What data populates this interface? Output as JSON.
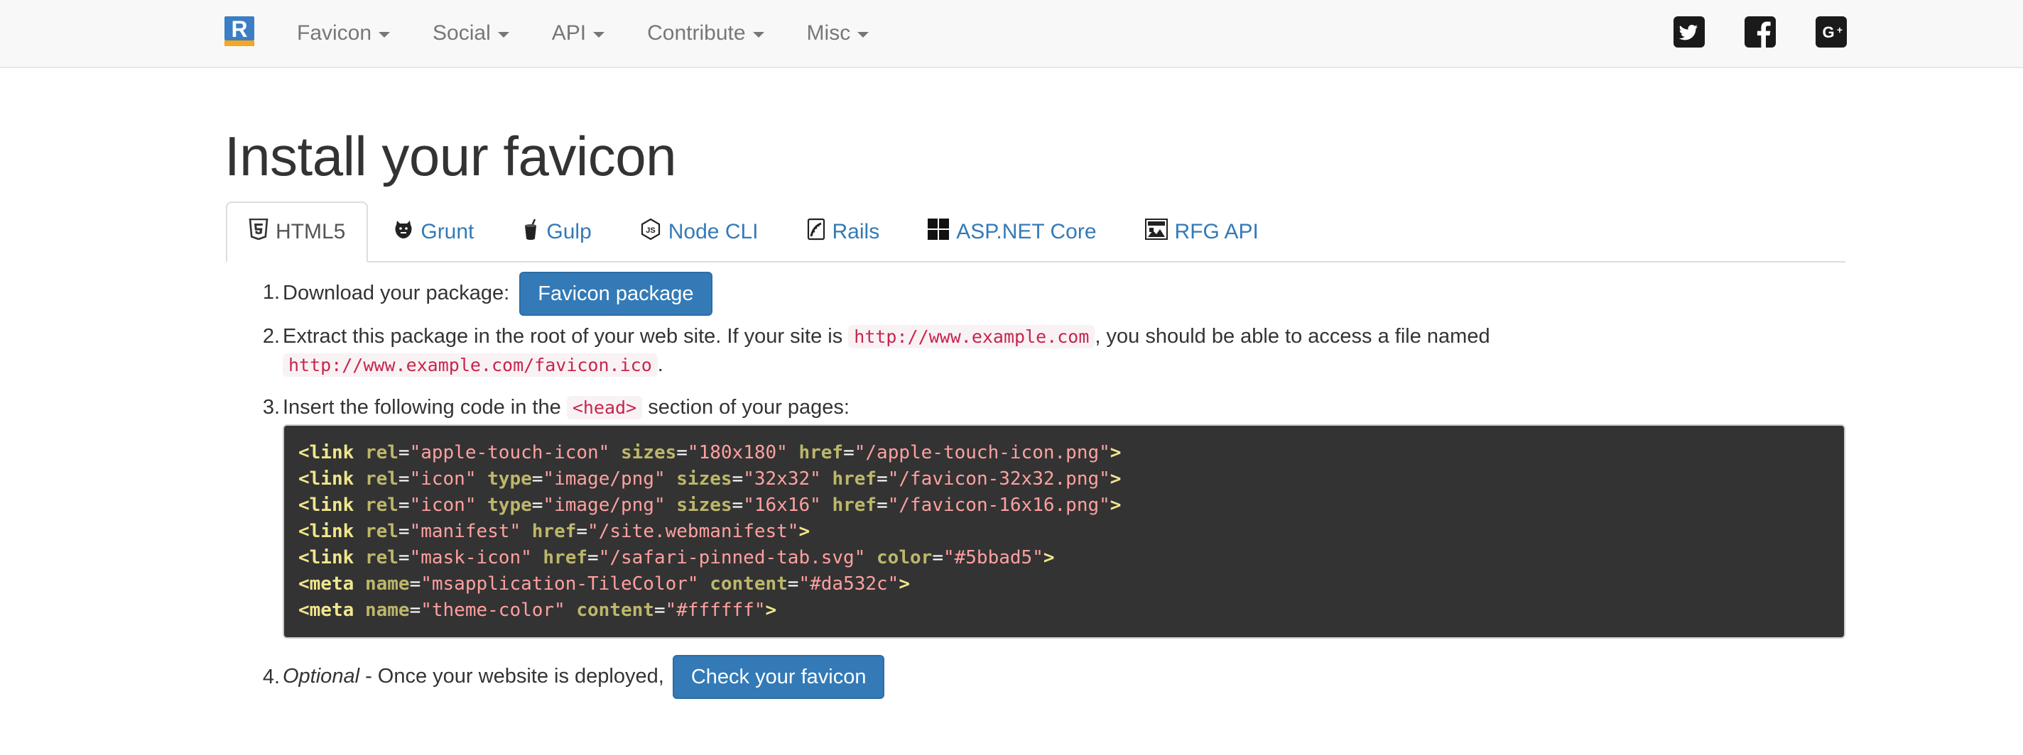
{
  "navbar": {
    "brand_icon": "realfavicongenerator-logo-icon",
    "menu": [
      {
        "label": "Favicon"
      },
      {
        "label": "Social"
      },
      {
        "label": "API"
      },
      {
        "label": "Contribute"
      },
      {
        "label": "Misc"
      }
    ],
    "social_icons": [
      "twitter-icon",
      "facebook-icon",
      "google-plus-icon"
    ]
  },
  "page": {
    "title": "Install your favicon"
  },
  "tabs": [
    {
      "label": "HTML5",
      "icon": "html5-icon",
      "active": true
    },
    {
      "label": "Grunt",
      "icon": "grunt-icon",
      "active": false
    },
    {
      "label": "Gulp",
      "icon": "gulp-icon",
      "active": false
    },
    {
      "label": "Node CLI",
      "icon": "nodejs-icon",
      "active": false
    },
    {
      "label": "Rails",
      "icon": "rails-icon",
      "active": false
    },
    {
      "label": "ASP.NET Core",
      "icon": "windows-icon",
      "active": false
    },
    {
      "label": "RFG API",
      "icon": "rfg-api-icon",
      "active": false
    }
  ],
  "steps": {
    "step1": {
      "number": "1.",
      "text": "Download your package:",
      "button_label": "Favicon package"
    },
    "step2": {
      "number": "2.",
      "text_a": "Extract this package in the root of your web site. If your site is",
      "code_site": "http://www.example.com",
      "text_b": ", you should be able to access a file named",
      "code_file": "http://www.example.com/favicon.ico",
      "text_c": "."
    },
    "step3": {
      "number": "3.",
      "text_a": "Insert the following code in the",
      "code_head": "<head>",
      "text_b": "section of your pages:"
    },
    "step4": {
      "number": "4.",
      "optional": "Optional",
      "text": " - Once your website is deployed,",
      "button_label": "Check your favicon"
    }
  },
  "code_lines": [
    [
      [
        "tag",
        "<link"
      ],
      [
        "sp",
        " "
      ],
      [
        "attr",
        "rel"
      ],
      [
        "eq",
        "="
      ],
      [
        "val",
        "\"apple-touch-icon\""
      ],
      [
        "sp",
        " "
      ],
      [
        "attr",
        "sizes"
      ],
      [
        "eq",
        "="
      ],
      [
        "val",
        "\"180x180\""
      ],
      [
        "sp",
        " "
      ],
      [
        "attr",
        "href"
      ],
      [
        "eq",
        "="
      ],
      [
        "val",
        "\"/apple-touch-icon.png\""
      ],
      [
        "tag",
        ">"
      ]
    ],
    [
      [
        "tag",
        "<link"
      ],
      [
        "sp",
        " "
      ],
      [
        "attr",
        "rel"
      ],
      [
        "eq",
        "="
      ],
      [
        "val",
        "\"icon\""
      ],
      [
        "sp",
        " "
      ],
      [
        "attr",
        "type"
      ],
      [
        "eq",
        "="
      ],
      [
        "val",
        "\"image/png\""
      ],
      [
        "sp",
        " "
      ],
      [
        "attr",
        "sizes"
      ],
      [
        "eq",
        "="
      ],
      [
        "val",
        "\"32x32\""
      ],
      [
        "sp",
        " "
      ],
      [
        "attr",
        "href"
      ],
      [
        "eq",
        "="
      ],
      [
        "val",
        "\"/favicon-32x32.png\""
      ],
      [
        "tag",
        ">"
      ]
    ],
    [
      [
        "tag",
        "<link"
      ],
      [
        "sp",
        " "
      ],
      [
        "attr",
        "rel"
      ],
      [
        "eq",
        "="
      ],
      [
        "val",
        "\"icon\""
      ],
      [
        "sp",
        " "
      ],
      [
        "attr",
        "type"
      ],
      [
        "eq",
        "="
      ],
      [
        "val",
        "\"image/png\""
      ],
      [
        "sp",
        " "
      ],
      [
        "attr",
        "sizes"
      ],
      [
        "eq",
        "="
      ],
      [
        "val",
        "\"16x16\""
      ],
      [
        "sp",
        " "
      ],
      [
        "attr",
        "href"
      ],
      [
        "eq",
        "="
      ],
      [
        "val",
        "\"/favicon-16x16.png\""
      ],
      [
        "tag",
        ">"
      ]
    ],
    [
      [
        "tag",
        "<link"
      ],
      [
        "sp",
        " "
      ],
      [
        "attr",
        "rel"
      ],
      [
        "eq",
        "="
      ],
      [
        "val",
        "\"manifest\""
      ],
      [
        "sp",
        " "
      ],
      [
        "attr",
        "href"
      ],
      [
        "eq",
        "="
      ],
      [
        "val",
        "\"/site.webmanifest\""
      ],
      [
        "tag",
        ">"
      ]
    ],
    [
      [
        "tag",
        "<link"
      ],
      [
        "sp",
        " "
      ],
      [
        "attr",
        "rel"
      ],
      [
        "eq",
        "="
      ],
      [
        "val",
        "\"mask-icon\""
      ],
      [
        "sp",
        " "
      ],
      [
        "attr",
        "href"
      ],
      [
        "eq",
        "="
      ],
      [
        "val",
        "\"/safari-pinned-tab.svg\""
      ],
      [
        "sp",
        " "
      ],
      [
        "attr",
        "color"
      ],
      [
        "eq",
        "="
      ],
      [
        "val",
        "\"#5bbad5\""
      ],
      [
        "tag",
        ">"
      ]
    ],
    [
      [
        "tag",
        "<meta"
      ],
      [
        "sp",
        " "
      ],
      [
        "attr",
        "name"
      ],
      [
        "eq",
        "="
      ],
      [
        "val",
        "\"msapplication-TileColor\""
      ],
      [
        "sp",
        " "
      ],
      [
        "attr",
        "content"
      ],
      [
        "eq",
        "="
      ],
      [
        "val",
        "\"#da532c\""
      ],
      [
        "tag",
        ">"
      ]
    ],
    [
      [
        "tag",
        "<meta"
      ],
      [
        "sp",
        " "
      ],
      [
        "attr",
        "name"
      ],
      [
        "eq",
        "="
      ],
      [
        "val",
        "\"theme-color\""
      ],
      [
        "sp",
        " "
      ],
      [
        "attr",
        "content"
      ],
      [
        "eq",
        "="
      ],
      [
        "val",
        "\"#ffffff\""
      ],
      [
        "tag",
        ">"
      ]
    ]
  ],
  "colors": {
    "link": "#337ab7",
    "button": "#337ab7",
    "code_bg": "#333333",
    "inline_code": "#c7254e",
    "nav_bg": "#f8f8f8"
  }
}
